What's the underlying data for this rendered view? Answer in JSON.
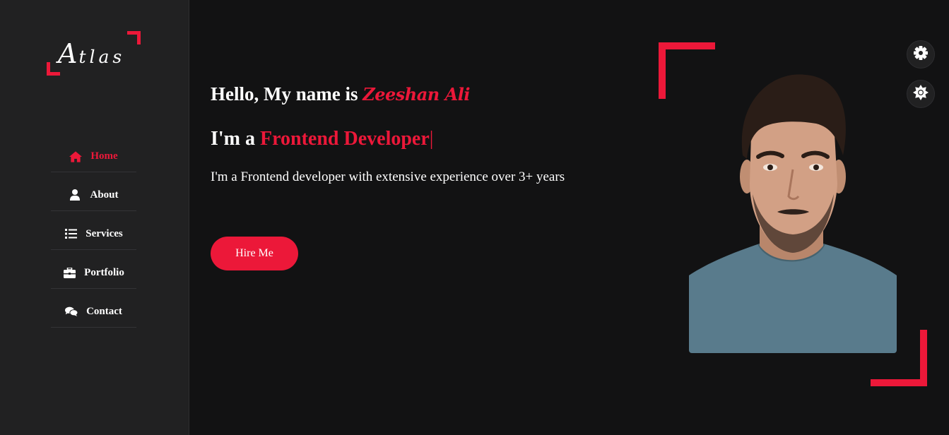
{
  "logo": {
    "first_letter": "A",
    "rest": "tlas"
  },
  "nav": {
    "items": [
      {
        "label": "Home",
        "icon": "home-icon",
        "active": true
      },
      {
        "label": "About",
        "icon": "user-icon",
        "active": false
      },
      {
        "label": "Services",
        "icon": "list-icon",
        "active": false
      },
      {
        "label": "Portfolio",
        "icon": "briefcase-icon",
        "active": false
      },
      {
        "label": "Contact",
        "icon": "comments-icon",
        "active": false
      }
    ]
  },
  "hero": {
    "greeting": "Hello, My name is ",
    "name": "Zeeshan Ali",
    "role_prefix": "I'm a ",
    "role": "Frontend Developer",
    "cursor": "|",
    "description": "I'm a Frontend developer with extensive experience over 3+ years",
    "button_label": "Hire Me"
  },
  "controls": {
    "settings_icon": "gear-icon",
    "theme_icon": "sun-icon"
  },
  "colors": {
    "accent": "#ec1839",
    "background": "#121213",
    "sidebar": "#212122"
  }
}
